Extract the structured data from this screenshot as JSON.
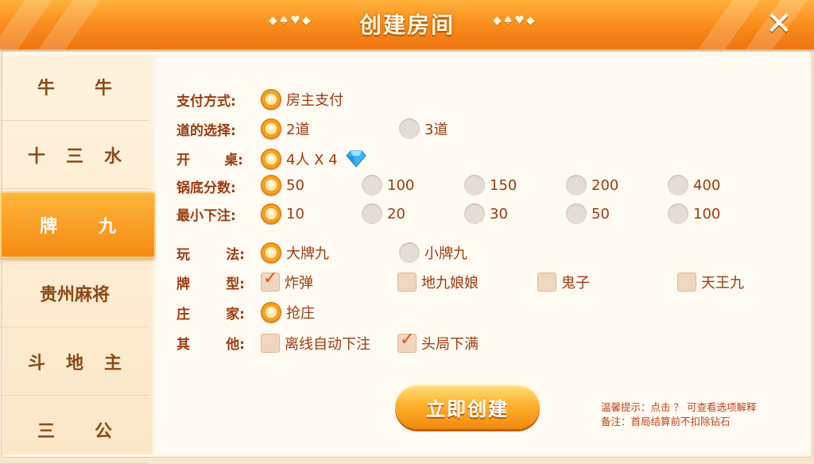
{
  "header": {
    "title": "创建房间",
    "deco_left": "◆♠♥◆",
    "deco_right": "◆♠♥◆",
    "close_label": "✕"
  },
  "sidebar": {
    "items": [
      {
        "parts": [
          "牛",
          "牛"
        ]
      },
      {
        "parts": [
          "十",
          "三",
          "水"
        ]
      },
      {
        "parts": [
          "牌",
          "九"
        ]
      },
      {
        "parts": [
          "贵州麻将"
        ]
      },
      {
        "parts": [
          "斗",
          "地",
          "主"
        ]
      },
      {
        "parts": [
          "三",
          "公"
        ]
      }
    ],
    "active_index": 2
  },
  "form": {
    "pay": {
      "label": "支付方式:",
      "options": [
        "房主支付"
      ],
      "selected": 0
    },
    "lane": {
      "label": "道的选择:",
      "options": [
        "2道",
        "3道"
      ],
      "selected": 0
    },
    "table": {
      "label": [
        "开",
        "桌:"
      ],
      "options": [
        "4人 X 4"
      ],
      "selected": 0,
      "icon": "diamond-icon"
    },
    "base": {
      "label": "锅底分数:",
      "options": [
        "50",
        "100",
        "150",
        "200",
        "400"
      ],
      "selected": 0
    },
    "minbet": {
      "label": "最小下注:",
      "options": [
        "10",
        "20",
        "30",
        "50",
        "100"
      ],
      "selected": 0
    },
    "play": {
      "label": [
        "玩",
        "法:"
      ],
      "options": [
        "大牌九",
        "小牌九"
      ],
      "selected": 0
    },
    "card": {
      "label": [
        "牌",
        "型:"
      ],
      "options": [
        "炸弹",
        "地九娘娘",
        "鬼子",
        "天王九"
      ],
      "checked": [
        true,
        false,
        false,
        false
      ]
    },
    "banker": {
      "label": [
        "庄",
        "家:"
      ],
      "options": [
        "抢庄"
      ],
      "selected": 0
    },
    "other": {
      "label": [
        "其",
        "他:"
      ],
      "options": [
        "离线自动下注",
        "头局下满"
      ],
      "checked": [
        false,
        true
      ]
    }
  },
  "create_button": "立即创建",
  "tips": {
    "line1": "温馨提示：点击 ？ 可查看选项解释",
    "line2": "备注：首局结算前不扣除钻石"
  },
  "colors": {
    "accent": "#f58a12",
    "label": "#9a3b10",
    "tip": "#c2441a"
  }
}
